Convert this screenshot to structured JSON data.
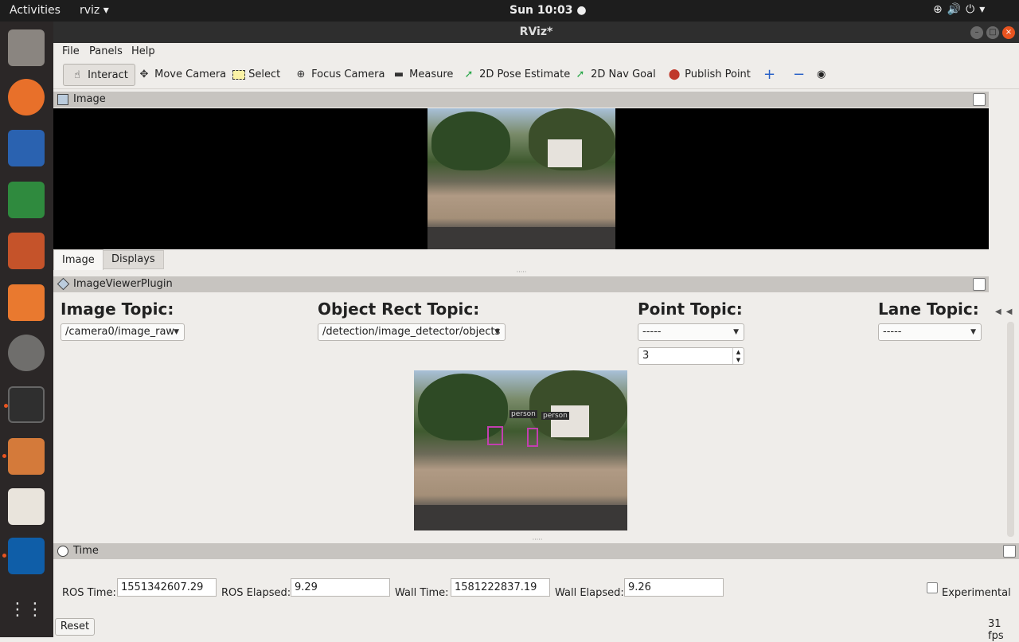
{
  "topbar": {
    "activities": "Activities",
    "app_menu": "rviz ▾",
    "clock": "Sun 10:03 ●",
    "tray": "⊕🔊⏻▾"
  },
  "dock": {
    "apps": [
      "files",
      "firefox",
      "writer",
      "calc",
      "impress",
      "software-center",
      "settings",
      "terminal",
      "file-roller",
      "text-editor",
      "autoware",
      "show-apps"
    ]
  },
  "window": {
    "title": "RViz*"
  },
  "menu": {
    "items": [
      "File",
      "Panels",
      "Help"
    ]
  },
  "toolbar": {
    "tools": [
      {
        "label": "Interact",
        "icon": "hand-icon"
      },
      {
        "label": "Move Camera",
        "icon": "move-camera-icon"
      },
      {
        "label": "Select",
        "icon": "select-icon"
      },
      {
        "label": "Focus Camera",
        "icon": "focus-camera-icon"
      },
      {
        "label": "Measure",
        "icon": "ruler-icon"
      },
      {
        "label": "2D Pose Estimate",
        "icon": "pose-arrow-icon"
      },
      {
        "label": "2D Nav Goal",
        "icon": "nav-arrow-icon"
      },
      {
        "label": "Publish Point",
        "icon": "map-pin-icon"
      }
    ]
  },
  "image_panel": {
    "title": "Image"
  },
  "tabs": {
    "image": "Image",
    "displays": "Displays"
  },
  "ivp": {
    "title": "ImageViewerPlugin",
    "image_topic_label": "Image Topic:",
    "image_topic_value": "/camera0/image_raw",
    "rect_topic_label": "Object Rect Topic:",
    "rect_topic_value": "/detection/image_detector/objects",
    "point_topic_label": "Point Topic:",
    "point_topic_value": "-----",
    "point_size": "3",
    "lane_topic_label": "Lane Topic:",
    "lane_topic_value": "-----",
    "detections": [
      "person",
      "person"
    ]
  },
  "time": {
    "title": "Time",
    "ros_time_label": "ROS Time:",
    "ros_time": "1551342607.29",
    "ros_elapsed_label": "ROS Elapsed:",
    "ros_elapsed": "9.29",
    "wall_time_label": "Wall Time:",
    "wall_time": "1581222837.19",
    "wall_elapsed_label": "Wall Elapsed:",
    "wall_elapsed": "9.26",
    "experimental": "Experimental",
    "reset": "Reset",
    "fps": "31 fps"
  }
}
